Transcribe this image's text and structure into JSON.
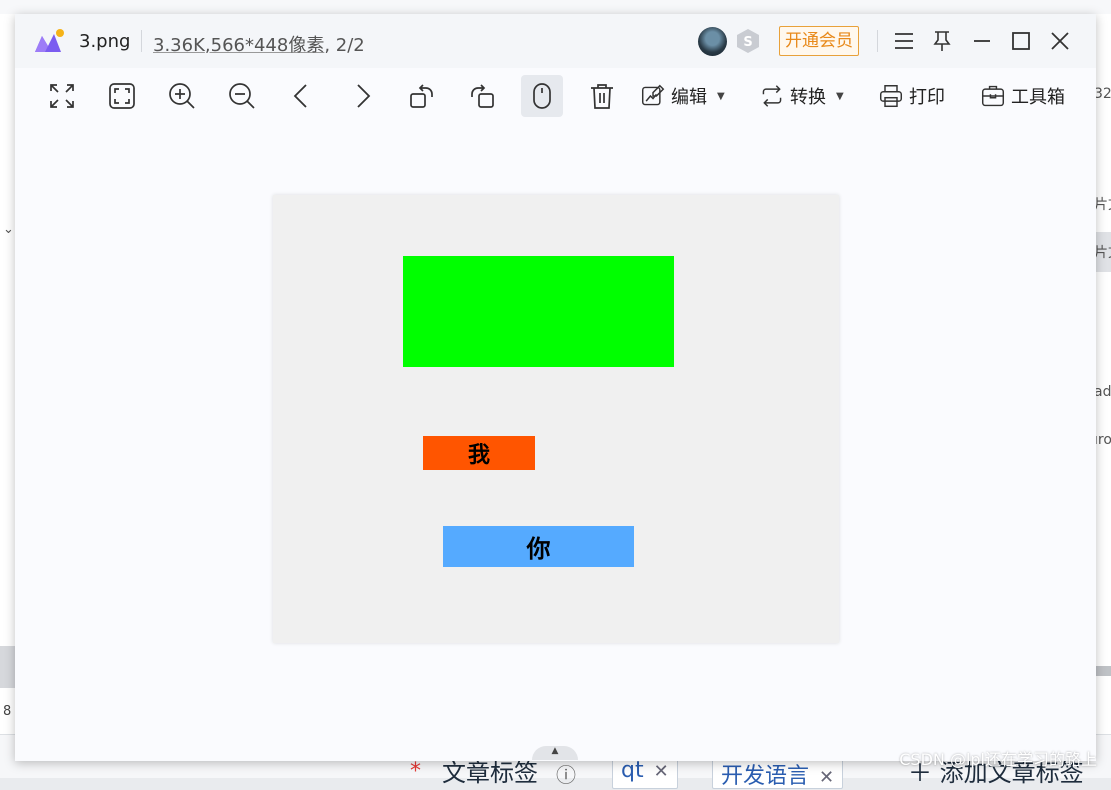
{
  "viewer": {
    "file_name": "3.png",
    "file_size": "3.36K",
    "dimensions": ",566*448像素",
    "page_index": ", 2/2",
    "vip_label": "开通会员",
    "colors": {
      "vip_accent": "#e8891a",
      "titlebar_bg": "#f4f6f9",
      "window_bg": "#fafbfe"
    }
  },
  "toolbar": {
    "fit_screen_icon": "collapse-arrows-icon",
    "fullscreen_icon": "fullscreen-icon",
    "zoom_in_icon": "zoom-in-icon",
    "zoom_out_icon": "zoom-out-icon",
    "prev_icon": "chevron-left-icon",
    "next_icon": "chevron-right-icon",
    "rotate_left_icon": "rotate-left-icon",
    "rotate_right_icon": "rotate-right-icon",
    "mouse_icon": "mouse-icon",
    "delete_icon": "trash-icon",
    "edit_label": "编辑",
    "convert_label": "转换",
    "print_label": "打印",
    "toolbox_label": "工具箱"
  },
  "image_content": {
    "canvas_bg": "#f0f0f0",
    "green_color": "#00ff00",
    "orange_color": "#ff5500",
    "orange_text": "我",
    "blue_color": "#55aaff",
    "blue_text": "你"
  },
  "background": {
    "right_fragments": [
      "32",
      "片文",
      "片文",
      "ad",
      "ıro"
    ],
    "left_number": "8",
    "bottom_label": "文章标签",
    "bottom_tag_1": "qt",
    "bottom_tag_2": "开发语言",
    "bottom_add": "＋ 添加文章标签",
    "watermark": "CSDN @lpl还在学习的路上"
  }
}
